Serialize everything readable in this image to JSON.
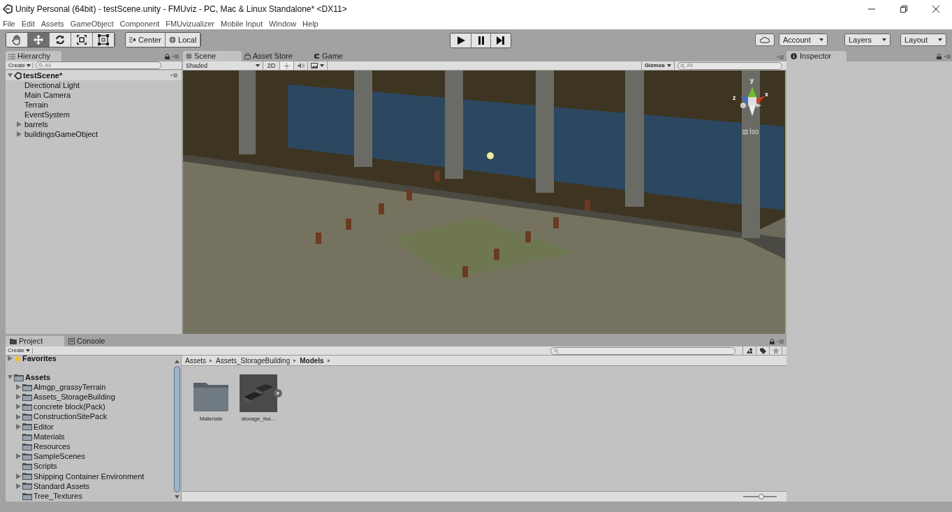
{
  "window": {
    "title": "Unity Personal (64bit) - testScene.unity - FMUviz - PC, Mac & Linux Standalone* <DX11>"
  },
  "menu": [
    "File",
    "Edit",
    "Assets",
    "GameObject",
    "Component",
    "FMUvizualizer",
    "Mobile Input",
    "Window",
    "Help"
  ],
  "toolbar": {
    "tools": [
      {
        "kind": "hand",
        "selected": false
      },
      {
        "kind": "move",
        "selected": true
      },
      {
        "kind": "rotate",
        "selected": false
      },
      {
        "kind": "scale",
        "selected": false
      },
      {
        "kind": "rect",
        "selected": false
      }
    ],
    "pivot": [
      "Center",
      "Local"
    ],
    "right_buttons": [
      "Account",
      "Layers",
      "Layout"
    ]
  },
  "hierarchy": {
    "tab": "Hierarchy",
    "create": "Create",
    "search": {
      "placeholder": "All"
    },
    "scene": "testScene*",
    "items": [
      {
        "name": "Directional Light",
        "kind": "object"
      },
      {
        "name": "Main Camera",
        "kind": "object"
      },
      {
        "name": "Terrain",
        "kind": "object"
      },
      {
        "name": "EventSystem",
        "kind": "object"
      },
      {
        "name": "barrels",
        "kind": "group"
      },
      {
        "name": "buildingsGameObject",
        "kind": "group"
      }
    ]
  },
  "scene_view": {
    "tabs": [
      {
        "label": "Scene",
        "kind": "scene",
        "selected": true
      },
      {
        "label": "Asset Store",
        "kind": "store",
        "selected": false
      },
      {
        "label": "Game",
        "kind": "game",
        "selected": false
      }
    ],
    "shading": "Shaded",
    "mode_2d": "2D",
    "gizmos": "Gizmos",
    "search": {
      "placeholder": "All"
    },
    "axis_labels": [
      "y",
      "x",
      "z"
    ],
    "projection": "Iso"
  },
  "inspector": {
    "tab": "Inspector"
  },
  "project": {
    "tabs": [
      {
        "label": "Project",
        "kind": "project",
        "selected": true
      },
      {
        "label": "Console",
        "kind": "console",
        "selected": false
      }
    ],
    "create": "Create",
    "tree": [
      {
        "name": "Favorites",
        "kind": "favorites"
      },
      {
        "name": "Assets",
        "kind": "folder",
        "children": [
          {
            "name": "Almgp_grassyTerrain",
            "kind": "group"
          },
          {
            "name": "Assets_StorageBuilding",
            "kind": "group"
          },
          {
            "name": "concrete block(Pack)",
            "kind": "group"
          },
          {
            "name": "ConstructionSitePack",
            "kind": "group"
          },
          {
            "name": "Editor",
            "kind": "group"
          },
          {
            "name": "Materials",
            "kind": "folder"
          },
          {
            "name": "Resources",
            "kind": "folder"
          },
          {
            "name": "SampleScenes",
            "kind": "group"
          },
          {
            "name": "Scripts",
            "kind": "folder"
          },
          {
            "name": "Shipping Container Environment",
            "kind": "group"
          },
          {
            "name": "Standard Assets",
            "kind": "group"
          },
          {
            "name": "Tree_Textures",
            "kind": "folder"
          }
        ]
      }
    ],
    "breadcrumb": [
      "Assets",
      "Assets_StorageBuilding",
      "Models"
    ],
    "assets": [
      {
        "name": "Materials",
        "kind": "folder"
      },
      {
        "name": "storage_bui...",
        "kind": "model"
      }
    ],
    "zoom": {
      "level": 0.55
    }
  }
}
